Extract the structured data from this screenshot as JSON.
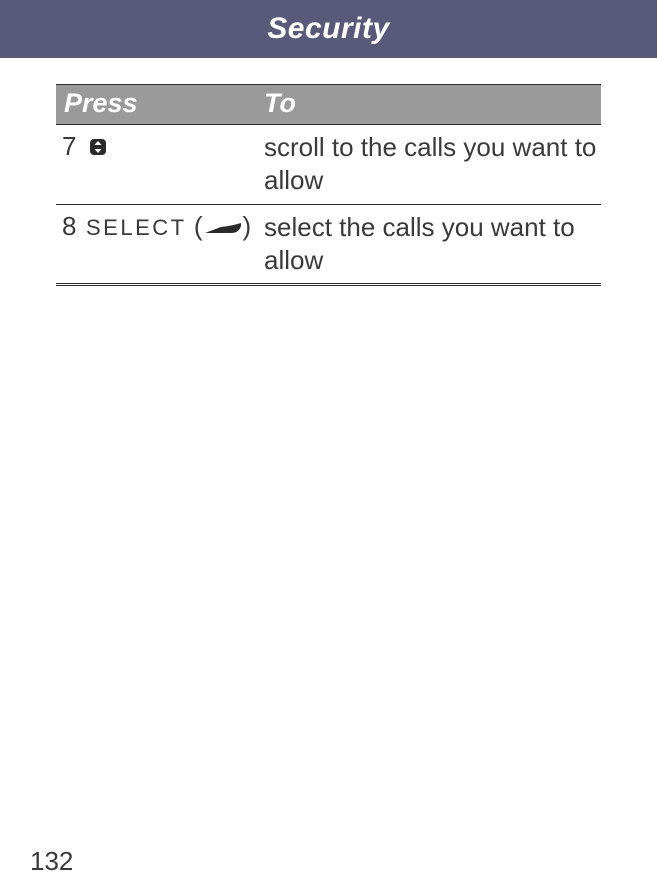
{
  "header": {
    "title": "Security"
  },
  "table": {
    "columns": {
      "press": "Press",
      "to": "To"
    },
    "rows": [
      {
        "step": "7",
        "press_label": "",
        "icon": "scroll",
        "to": "scroll to the calls you want to allow"
      },
      {
        "step": "8",
        "press_label": "SELECT",
        "icon": "softkey",
        "to": "select the calls you want to allow"
      }
    ]
  },
  "page_number": "132"
}
